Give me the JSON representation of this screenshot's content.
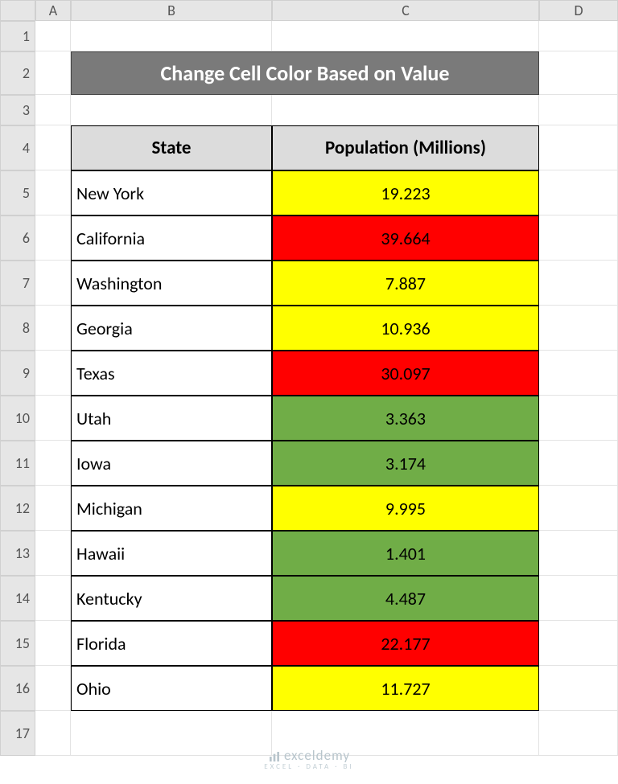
{
  "columns": [
    "A",
    "B",
    "C",
    "D"
  ],
  "row_count": 17,
  "title": "Change Cell Color Based on Value",
  "headers": {
    "state": "State",
    "population": "Population (Millions)"
  },
  "rows": [
    {
      "state": "New York",
      "population": "19.223",
      "color": "yellow"
    },
    {
      "state": "California",
      "population": "39.664",
      "color": "red"
    },
    {
      "state": "Washington",
      "population": "7.887",
      "color": "yellow"
    },
    {
      "state": "Georgia",
      "population": "10.936",
      "color": "yellow"
    },
    {
      "state": "Texas",
      "population": "30.097",
      "color": "red"
    },
    {
      "state": "Utah",
      "population": "3.363",
      "color": "green"
    },
    {
      "state": "Iowa",
      "population": "3.174",
      "color": "green"
    },
    {
      "state": "Michigan",
      "population": "9.995",
      "color": "yellow"
    },
    {
      "state": "Hawaii",
      "population": "1.401",
      "color": "green"
    },
    {
      "state": "Kentucky",
      "population": "4.487",
      "color": "green"
    },
    {
      "state": "Florida",
      "population": "22.177",
      "color": "red"
    },
    {
      "state": "Ohio",
      "population": "11.727",
      "color": "yellow"
    }
  ],
  "watermark": {
    "brand": "exceldemy",
    "tag": "EXCEL · DATA · BI"
  }
}
